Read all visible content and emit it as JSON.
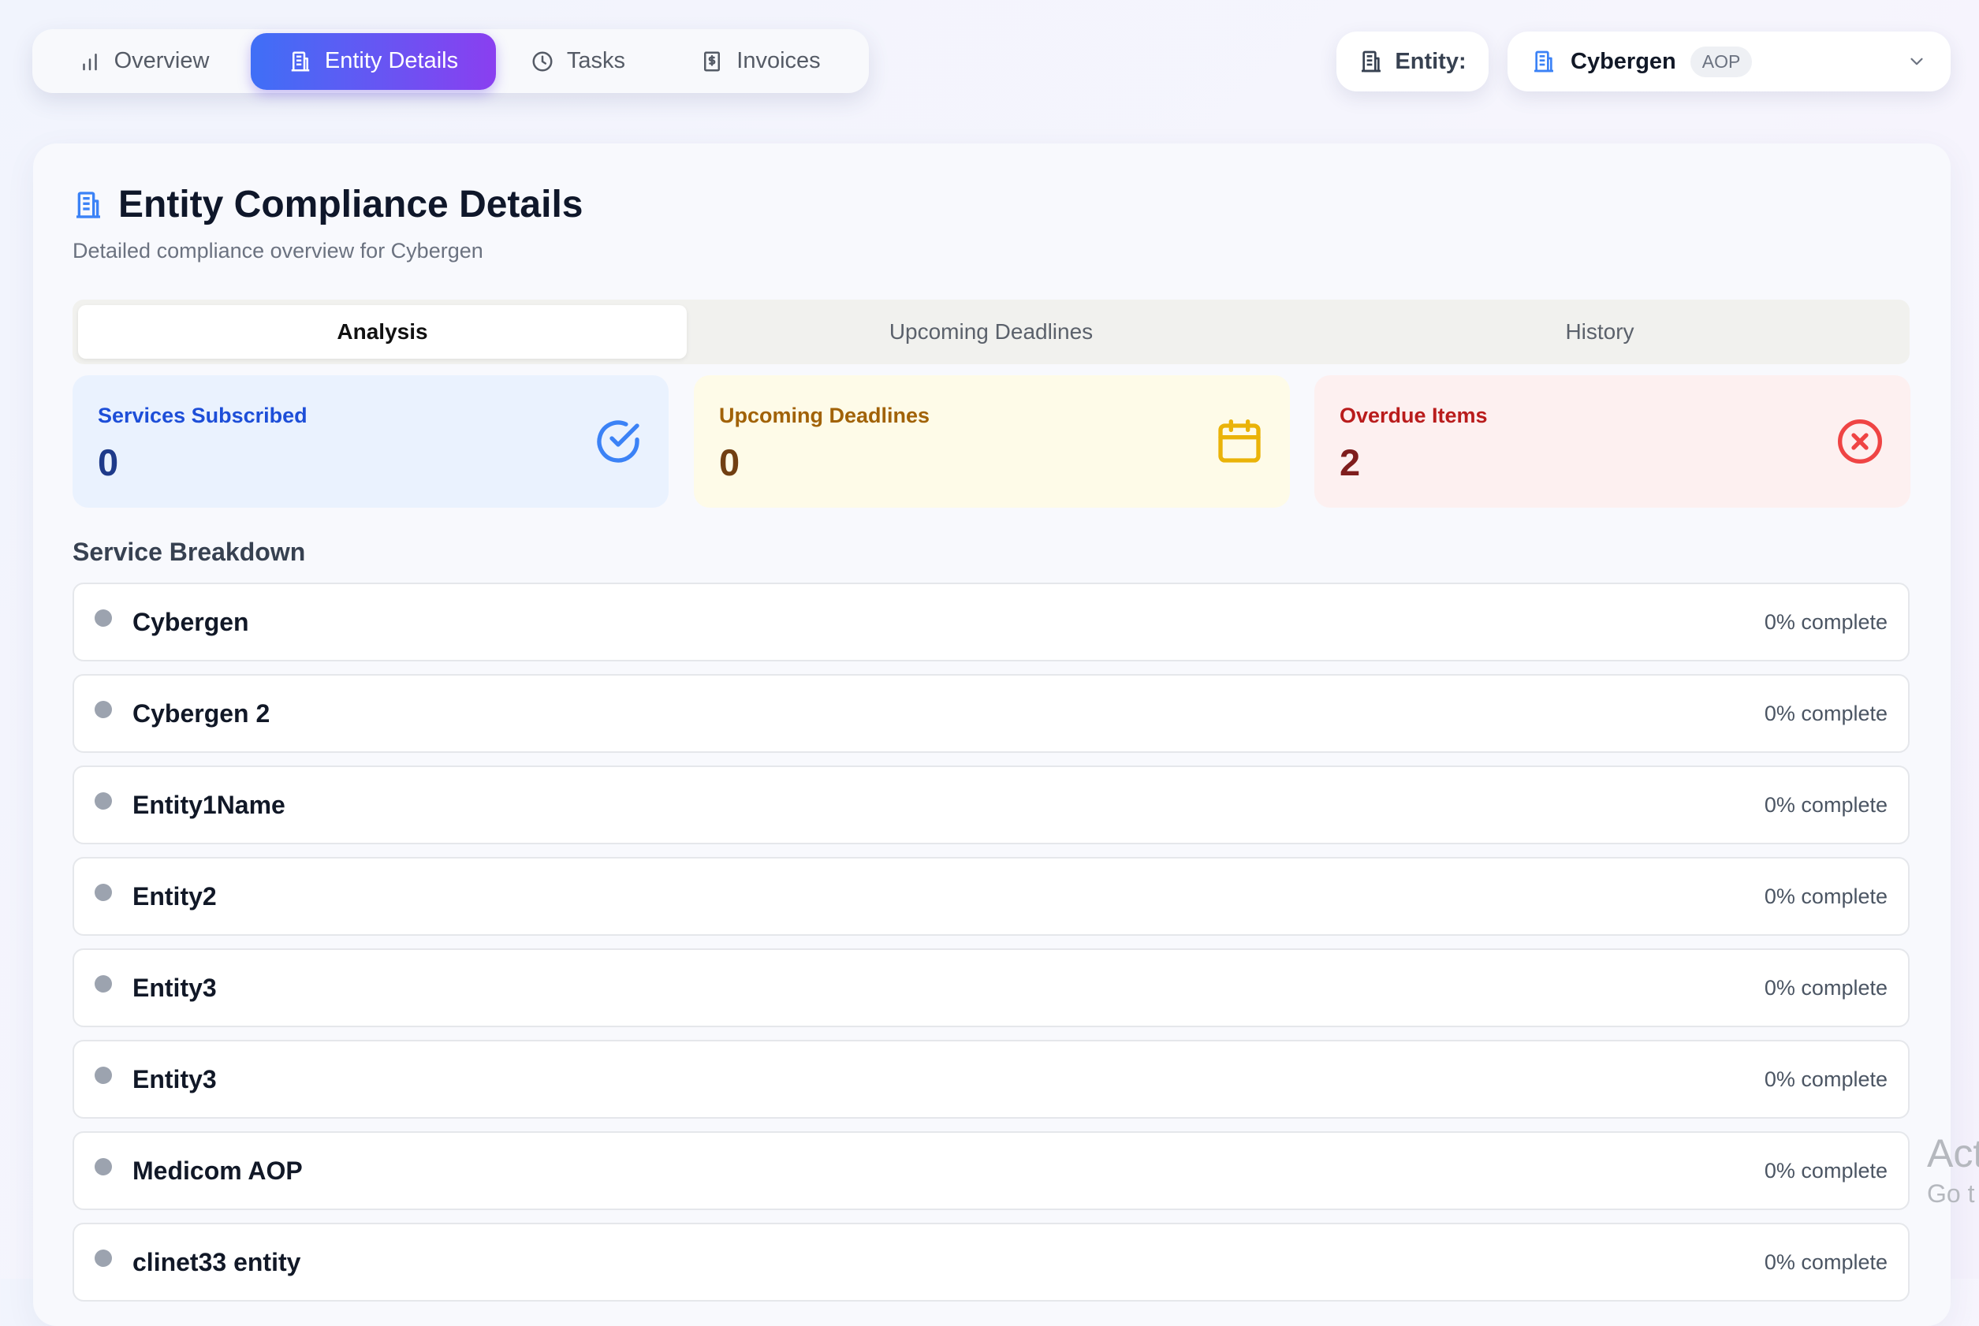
{
  "nav": {
    "items": [
      {
        "label": "Overview",
        "icon": "bar-chart-icon",
        "active": false
      },
      {
        "label": "Entity Details",
        "icon": "building-icon",
        "active": true
      },
      {
        "label": "Tasks",
        "icon": "clock-icon",
        "active": false
      },
      {
        "label": "Invoices",
        "icon": "receipt-icon",
        "active": false
      }
    ]
  },
  "entity_picker": {
    "label": "Entity:",
    "selected_name": "Cybergen",
    "selected_type": "AOP"
  },
  "page": {
    "title": "Entity Compliance Details",
    "subtitle": "Detailed compliance overview for Cybergen"
  },
  "tabs": [
    {
      "label": "Analysis",
      "active": true
    },
    {
      "label": "Upcoming Deadlines",
      "active": false
    },
    {
      "label": "History",
      "active": false
    }
  ],
  "stats": {
    "services_subscribed": {
      "label": "Services Subscribed",
      "value": "0",
      "icon": "check-circle-icon"
    },
    "upcoming_deadlines": {
      "label": "Upcoming Deadlines",
      "value": "0",
      "icon": "calendar-icon"
    },
    "overdue_items": {
      "label": "Overdue Items",
      "value": "2",
      "icon": "x-circle-icon"
    }
  },
  "service_breakdown": {
    "title": "Service Breakdown",
    "items": [
      {
        "name": "Cybergen",
        "progress": "0% complete"
      },
      {
        "name": "Cybergen 2",
        "progress": "0% complete"
      },
      {
        "name": "Entity1Name",
        "progress": "0% complete"
      },
      {
        "name": "Entity2",
        "progress": "0% complete"
      },
      {
        "name": "Entity3",
        "progress": "0% complete"
      },
      {
        "name": "Entity3",
        "progress": "0% complete"
      },
      {
        "name": "Medicom AOP",
        "progress": "0% complete"
      },
      {
        "name": "clinet33 entity",
        "progress": "0% complete"
      }
    ]
  },
  "watermark": {
    "line1": "Act",
    "line2": "Go t"
  },
  "colors": {
    "accent_gradient_start": "#3f6ff6",
    "accent_gradient_end": "#8a3ff0",
    "blue": "#3b82f6",
    "yellow": "#eab308",
    "red": "#ef4444"
  }
}
